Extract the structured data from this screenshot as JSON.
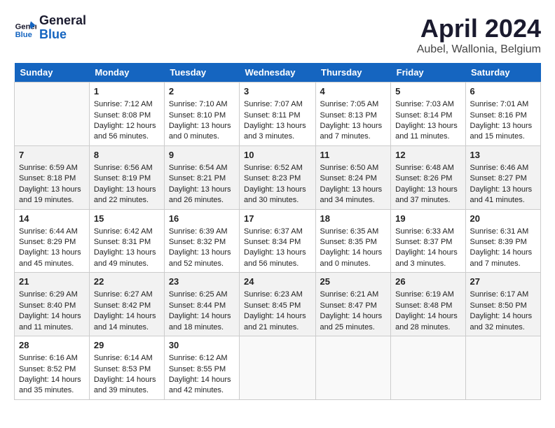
{
  "header": {
    "logo_line1": "General",
    "logo_line2": "Blue",
    "title": "April 2024",
    "location": "Aubel, Wallonia, Belgium"
  },
  "weekdays": [
    "Sunday",
    "Monday",
    "Tuesday",
    "Wednesday",
    "Thursday",
    "Friday",
    "Saturday"
  ],
  "weeks": [
    [
      {
        "day": "",
        "empty": true
      },
      {
        "day": "1",
        "sunrise": "Sunrise: 7:12 AM",
        "sunset": "Sunset: 8:08 PM",
        "daylight": "Daylight: 12 hours and 56 minutes."
      },
      {
        "day": "2",
        "sunrise": "Sunrise: 7:10 AM",
        "sunset": "Sunset: 8:10 PM",
        "daylight": "Daylight: 13 hours and 0 minutes."
      },
      {
        "day": "3",
        "sunrise": "Sunrise: 7:07 AM",
        "sunset": "Sunset: 8:11 PM",
        "daylight": "Daylight: 13 hours and 3 minutes."
      },
      {
        "day": "4",
        "sunrise": "Sunrise: 7:05 AM",
        "sunset": "Sunset: 8:13 PM",
        "daylight": "Daylight: 13 hours and 7 minutes."
      },
      {
        "day": "5",
        "sunrise": "Sunrise: 7:03 AM",
        "sunset": "Sunset: 8:14 PM",
        "daylight": "Daylight: 13 hours and 11 minutes."
      },
      {
        "day": "6",
        "sunrise": "Sunrise: 7:01 AM",
        "sunset": "Sunset: 8:16 PM",
        "daylight": "Daylight: 13 hours and 15 minutes."
      }
    ],
    [
      {
        "day": "7",
        "sunrise": "Sunrise: 6:59 AM",
        "sunset": "Sunset: 8:18 PM",
        "daylight": "Daylight: 13 hours and 19 minutes."
      },
      {
        "day": "8",
        "sunrise": "Sunrise: 6:56 AM",
        "sunset": "Sunset: 8:19 PM",
        "daylight": "Daylight: 13 hours and 22 minutes."
      },
      {
        "day": "9",
        "sunrise": "Sunrise: 6:54 AM",
        "sunset": "Sunset: 8:21 PM",
        "daylight": "Daylight: 13 hours and 26 minutes."
      },
      {
        "day": "10",
        "sunrise": "Sunrise: 6:52 AM",
        "sunset": "Sunset: 8:23 PM",
        "daylight": "Daylight: 13 hours and 30 minutes."
      },
      {
        "day": "11",
        "sunrise": "Sunrise: 6:50 AM",
        "sunset": "Sunset: 8:24 PM",
        "daylight": "Daylight: 13 hours and 34 minutes."
      },
      {
        "day": "12",
        "sunrise": "Sunrise: 6:48 AM",
        "sunset": "Sunset: 8:26 PM",
        "daylight": "Daylight: 13 hours and 37 minutes."
      },
      {
        "day": "13",
        "sunrise": "Sunrise: 6:46 AM",
        "sunset": "Sunset: 8:27 PM",
        "daylight": "Daylight: 13 hours and 41 minutes."
      }
    ],
    [
      {
        "day": "14",
        "sunrise": "Sunrise: 6:44 AM",
        "sunset": "Sunset: 8:29 PM",
        "daylight": "Daylight: 13 hours and 45 minutes."
      },
      {
        "day": "15",
        "sunrise": "Sunrise: 6:42 AM",
        "sunset": "Sunset: 8:31 PM",
        "daylight": "Daylight: 13 hours and 49 minutes."
      },
      {
        "day": "16",
        "sunrise": "Sunrise: 6:39 AM",
        "sunset": "Sunset: 8:32 PM",
        "daylight": "Daylight: 13 hours and 52 minutes."
      },
      {
        "day": "17",
        "sunrise": "Sunrise: 6:37 AM",
        "sunset": "Sunset: 8:34 PM",
        "daylight": "Daylight: 13 hours and 56 minutes."
      },
      {
        "day": "18",
        "sunrise": "Sunrise: 6:35 AM",
        "sunset": "Sunset: 8:35 PM",
        "daylight": "Daylight: 14 hours and 0 minutes."
      },
      {
        "day": "19",
        "sunrise": "Sunrise: 6:33 AM",
        "sunset": "Sunset: 8:37 PM",
        "daylight": "Daylight: 14 hours and 3 minutes."
      },
      {
        "day": "20",
        "sunrise": "Sunrise: 6:31 AM",
        "sunset": "Sunset: 8:39 PM",
        "daylight": "Daylight: 14 hours and 7 minutes."
      }
    ],
    [
      {
        "day": "21",
        "sunrise": "Sunrise: 6:29 AM",
        "sunset": "Sunset: 8:40 PM",
        "daylight": "Daylight: 14 hours and 11 minutes."
      },
      {
        "day": "22",
        "sunrise": "Sunrise: 6:27 AM",
        "sunset": "Sunset: 8:42 PM",
        "daylight": "Daylight: 14 hours and 14 minutes."
      },
      {
        "day": "23",
        "sunrise": "Sunrise: 6:25 AM",
        "sunset": "Sunset: 8:44 PM",
        "daylight": "Daylight: 14 hours and 18 minutes."
      },
      {
        "day": "24",
        "sunrise": "Sunrise: 6:23 AM",
        "sunset": "Sunset: 8:45 PM",
        "daylight": "Daylight: 14 hours and 21 minutes."
      },
      {
        "day": "25",
        "sunrise": "Sunrise: 6:21 AM",
        "sunset": "Sunset: 8:47 PM",
        "daylight": "Daylight: 14 hours and 25 minutes."
      },
      {
        "day": "26",
        "sunrise": "Sunrise: 6:19 AM",
        "sunset": "Sunset: 8:48 PM",
        "daylight": "Daylight: 14 hours and 28 minutes."
      },
      {
        "day": "27",
        "sunrise": "Sunrise: 6:17 AM",
        "sunset": "Sunset: 8:50 PM",
        "daylight": "Daylight: 14 hours and 32 minutes."
      }
    ],
    [
      {
        "day": "28",
        "sunrise": "Sunrise: 6:16 AM",
        "sunset": "Sunset: 8:52 PM",
        "daylight": "Daylight: 14 hours and 35 minutes."
      },
      {
        "day": "29",
        "sunrise": "Sunrise: 6:14 AM",
        "sunset": "Sunset: 8:53 PM",
        "daylight": "Daylight: 14 hours and 39 minutes."
      },
      {
        "day": "30",
        "sunrise": "Sunrise: 6:12 AM",
        "sunset": "Sunset: 8:55 PM",
        "daylight": "Daylight: 14 hours and 42 minutes."
      },
      {
        "day": "",
        "empty": true
      },
      {
        "day": "",
        "empty": true
      },
      {
        "day": "",
        "empty": true
      },
      {
        "day": "",
        "empty": true
      }
    ]
  ]
}
